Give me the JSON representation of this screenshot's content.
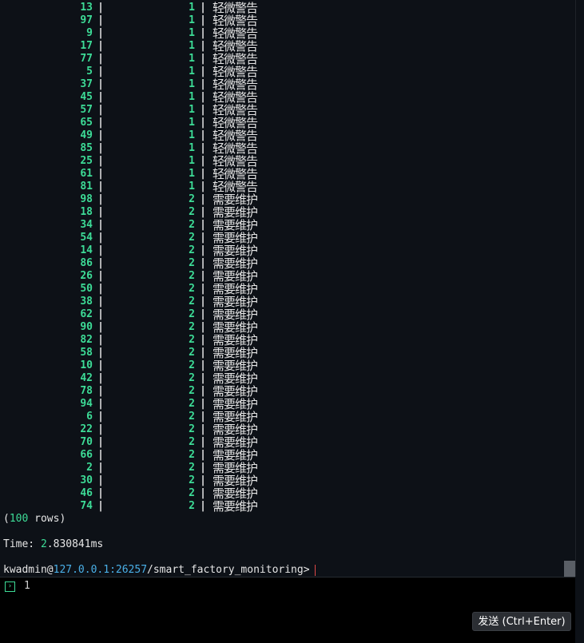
{
  "table": {
    "separator": "|",
    "rows": [
      {
        "id": "13",
        "level": "1",
        "status": "轻微警告"
      },
      {
        "id": "97",
        "level": "1",
        "status": "轻微警告"
      },
      {
        "id": "9",
        "level": "1",
        "status": "轻微警告"
      },
      {
        "id": "17",
        "level": "1",
        "status": "轻微警告"
      },
      {
        "id": "77",
        "level": "1",
        "status": "轻微警告"
      },
      {
        "id": "5",
        "level": "1",
        "status": "轻微警告"
      },
      {
        "id": "37",
        "level": "1",
        "status": "轻微警告"
      },
      {
        "id": "45",
        "level": "1",
        "status": "轻微警告"
      },
      {
        "id": "57",
        "level": "1",
        "status": "轻微警告"
      },
      {
        "id": "65",
        "level": "1",
        "status": "轻微警告"
      },
      {
        "id": "49",
        "level": "1",
        "status": "轻微警告"
      },
      {
        "id": "85",
        "level": "1",
        "status": "轻微警告"
      },
      {
        "id": "25",
        "level": "1",
        "status": "轻微警告"
      },
      {
        "id": "61",
        "level": "1",
        "status": "轻微警告"
      },
      {
        "id": "81",
        "level": "1",
        "status": "轻微警告"
      },
      {
        "id": "98",
        "level": "2",
        "status": "需要维护"
      },
      {
        "id": "18",
        "level": "2",
        "status": "需要维护"
      },
      {
        "id": "34",
        "level": "2",
        "status": "需要维护"
      },
      {
        "id": "54",
        "level": "2",
        "status": "需要维护"
      },
      {
        "id": "14",
        "level": "2",
        "status": "需要维护"
      },
      {
        "id": "86",
        "level": "2",
        "status": "需要维护"
      },
      {
        "id": "26",
        "level": "2",
        "status": "需要维护"
      },
      {
        "id": "50",
        "level": "2",
        "status": "需要维护"
      },
      {
        "id": "38",
        "level": "2",
        "status": "需要维护"
      },
      {
        "id": "62",
        "level": "2",
        "status": "需要维护"
      },
      {
        "id": "90",
        "level": "2",
        "status": "需要维护"
      },
      {
        "id": "82",
        "level": "2",
        "status": "需要维护"
      },
      {
        "id": "58",
        "level": "2",
        "status": "需要维护"
      },
      {
        "id": "10",
        "level": "2",
        "status": "需要维护"
      },
      {
        "id": "42",
        "level": "2",
        "status": "需要维护"
      },
      {
        "id": "78",
        "level": "2",
        "status": "需要维护"
      },
      {
        "id": "94",
        "level": "2",
        "status": "需要维护"
      },
      {
        "id": "6",
        "level": "2",
        "status": "需要维护"
      },
      {
        "id": "22",
        "level": "2",
        "status": "需要维护"
      },
      {
        "id": "70",
        "level": "2",
        "status": "需要维护"
      },
      {
        "id": "66",
        "level": "2",
        "status": "需要维护"
      },
      {
        "id": "2",
        "level": "2",
        "status": "需要维护"
      },
      {
        "id": "30",
        "level": "2",
        "status": "需要维护"
      },
      {
        "id": "46",
        "level": "2",
        "status": "需要维护"
      },
      {
        "id": "74",
        "level": "2",
        "status": "需要维护"
      }
    ]
  },
  "summary": {
    "open": "(",
    "count": "100",
    "label": " rows)"
  },
  "timing": {
    "label": "Time: ",
    "value_int": "2",
    "value_rest": ".830841ms"
  },
  "prompt": {
    "user": "kwadmin@",
    "host": "127.0.0.1:26257",
    "database": "/smart_factory_monitoring>"
  },
  "input": {
    "icon": "terminal-prompt-icon",
    "icon_glyph": "›",
    "value": "1"
  },
  "send_button": {
    "label": "发送 (Ctrl+Enter)"
  },
  "colors": {
    "background": "#0d1117",
    "number": "#3ddc97",
    "host": "#4ab0e8",
    "cursor": "#e04848"
  }
}
